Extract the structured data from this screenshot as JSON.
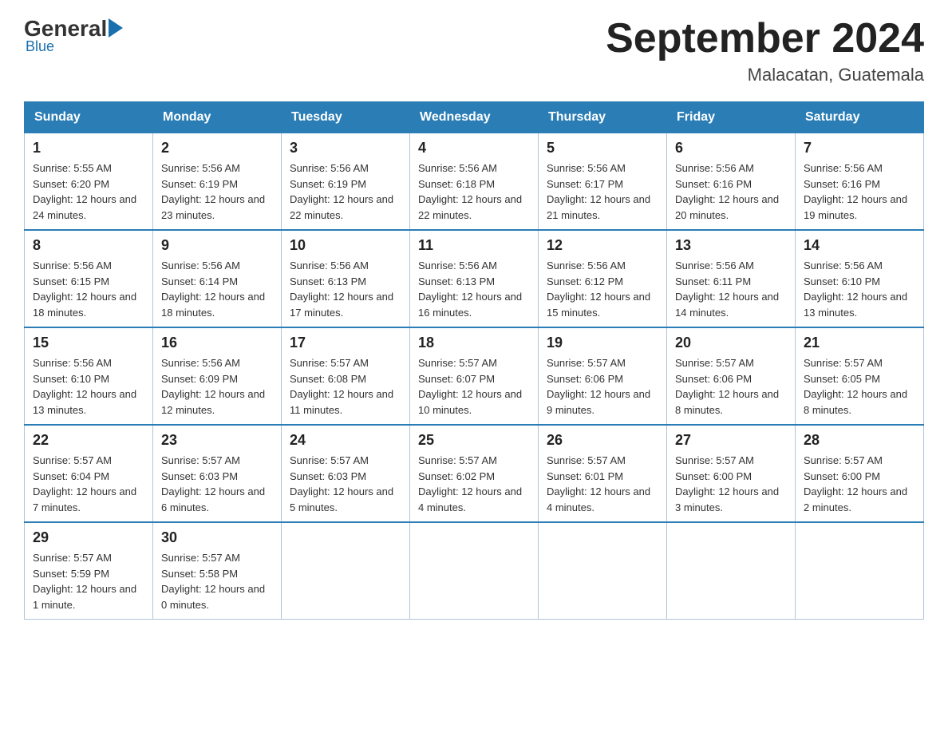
{
  "logo": {
    "general": "General",
    "blue": "Blue",
    "subtitle": "Blue"
  },
  "header": {
    "month_title": "September 2024",
    "location": "Malacatan, Guatemala"
  },
  "days_of_week": [
    "Sunday",
    "Monday",
    "Tuesday",
    "Wednesday",
    "Thursday",
    "Friday",
    "Saturday"
  ],
  "weeks": [
    [
      {
        "day": "1",
        "sunrise": "Sunrise: 5:55 AM",
        "sunset": "Sunset: 6:20 PM",
        "daylight": "Daylight: 12 hours and 24 minutes."
      },
      {
        "day": "2",
        "sunrise": "Sunrise: 5:56 AM",
        "sunset": "Sunset: 6:19 PM",
        "daylight": "Daylight: 12 hours and 23 minutes."
      },
      {
        "day": "3",
        "sunrise": "Sunrise: 5:56 AM",
        "sunset": "Sunset: 6:19 PM",
        "daylight": "Daylight: 12 hours and 22 minutes."
      },
      {
        "day": "4",
        "sunrise": "Sunrise: 5:56 AM",
        "sunset": "Sunset: 6:18 PM",
        "daylight": "Daylight: 12 hours and 22 minutes."
      },
      {
        "day": "5",
        "sunrise": "Sunrise: 5:56 AM",
        "sunset": "Sunset: 6:17 PM",
        "daylight": "Daylight: 12 hours and 21 minutes."
      },
      {
        "day": "6",
        "sunrise": "Sunrise: 5:56 AM",
        "sunset": "Sunset: 6:16 PM",
        "daylight": "Daylight: 12 hours and 20 minutes."
      },
      {
        "day": "7",
        "sunrise": "Sunrise: 5:56 AM",
        "sunset": "Sunset: 6:16 PM",
        "daylight": "Daylight: 12 hours and 19 minutes."
      }
    ],
    [
      {
        "day": "8",
        "sunrise": "Sunrise: 5:56 AM",
        "sunset": "Sunset: 6:15 PM",
        "daylight": "Daylight: 12 hours and 18 minutes."
      },
      {
        "day": "9",
        "sunrise": "Sunrise: 5:56 AM",
        "sunset": "Sunset: 6:14 PM",
        "daylight": "Daylight: 12 hours and 18 minutes."
      },
      {
        "day": "10",
        "sunrise": "Sunrise: 5:56 AM",
        "sunset": "Sunset: 6:13 PM",
        "daylight": "Daylight: 12 hours and 17 minutes."
      },
      {
        "day": "11",
        "sunrise": "Sunrise: 5:56 AM",
        "sunset": "Sunset: 6:13 PM",
        "daylight": "Daylight: 12 hours and 16 minutes."
      },
      {
        "day": "12",
        "sunrise": "Sunrise: 5:56 AM",
        "sunset": "Sunset: 6:12 PM",
        "daylight": "Daylight: 12 hours and 15 minutes."
      },
      {
        "day": "13",
        "sunrise": "Sunrise: 5:56 AM",
        "sunset": "Sunset: 6:11 PM",
        "daylight": "Daylight: 12 hours and 14 minutes."
      },
      {
        "day": "14",
        "sunrise": "Sunrise: 5:56 AM",
        "sunset": "Sunset: 6:10 PM",
        "daylight": "Daylight: 12 hours and 13 minutes."
      }
    ],
    [
      {
        "day": "15",
        "sunrise": "Sunrise: 5:56 AM",
        "sunset": "Sunset: 6:10 PM",
        "daylight": "Daylight: 12 hours and 13 minutes."
      },
      {
        "day": "16",
        "sunrise": "Sunrise: 5:56 AM",
        "sunset": "Sunset: 6:09 PM",
        "daylight": "Daylight: 12 hours and 12 minutes."
      },
      {
        "day": "17",
        "sunrise": "Sunrise: 5:57 AM",
        "sunset": "Sunset: 6:08 PM",
        "daylight": "Daylight: 12 hours and 11 minutes."
      },
      {
        "day": "18",
        "sunrise": "Sunrise: 5:57 AM",
        "sunset": "Sunset: 6:07 PM",
        "daylight": "Daylight: 12 hours and 10 minutes."
      },
      {
        "day": "19",
        "sunrise": "Sunrise: 5:57 AM",
        "sunset": "Sunset: 6:06 PM",
        "daylight": "Daylight: 12 hours and 9 minutes."
      },
      {
        "day": "20",
        "sunrise": "Sunrise: 5:57 AM",
        "sunset": "Sunset: 6:06 PM",
        "daylight": "Daylight: 12 hours and 8 minutes."
      },
      {
        "day": "21",
        "sunrise": "Sunrise: 5:57 AM",
        "sunset": "Sunset: 6:05 PM",
        "daylight": "Daylight: 12 hours and 8 minutes."
      }
    ],
    [
      {
        "day": "22",
        "sunrise": "Sunrise: 5:57 AM",
        "sunset": "Sunset: 6:04 PM",
        "daylight": "Daylight: 12 hours and 7 minutes."
      },
      {
        "day": "23",
        "sunrise": "Sunrise: 5:57 AM",
        "sunset": "Sunset: 6:03 PM",
        "daylight": "Daylight: 12 hours and 6 minutes."
      },
      {
        "day": "24",
        "sunrise": "Sunrise: 5:57 AM",
        "sunset": "Sunset: 6:03 PM",
        "daylight": "Daylight: 12 hours and 5 minutes."
      },
      {
        "day": "25",
        "sunrise": "Sunrise: 5:57 AM",
        "sunset": "Sunset: 6:02 PM",
        "daylight": "Daylight: 12 hours and 4 minutes."
      },
      {
        "day": "26",
        "sunrise": "Sunrise: 5:57 AM",
        "sunset": "Sunset: 6:01 PM",
        "daylight": "Daylight: 12 hours and 4 minutes."
      },
      {
        "day": "27",
        "sunrise": "Sunrise: 5:57 AM",
        "sunset": "Sunset: 6:00 PM",
        "daylight": "Daylight: 12 hours and 3 minutes."
      },
      {
        "day": "28",
        "sunrise": "Sunrise: 5:57 AM",
        "sunset": "Sunset: 6:00 PM",
        "daylight": "Daylight: 12 hours and 2 minutes."
      }
    ],
    [
      {
        "day": "29",
        "sunrise": "Sunrise: 5:57 AM",
        "sunset": "Sunset: 5:59 PM",
        "daylight": "Daylight: 12 hours and 1 minute."
      },
      {
        "day": "30",
        "sunrise": "Sunrise: 5:57 AM",
        "sunset": "Sunset: 5:58 PM",
        "daylight": "Daylight: 12 hours and 0 minutes."
      },
      null,
      null,
      null,
      null,
      null
    ]
  ]
}
